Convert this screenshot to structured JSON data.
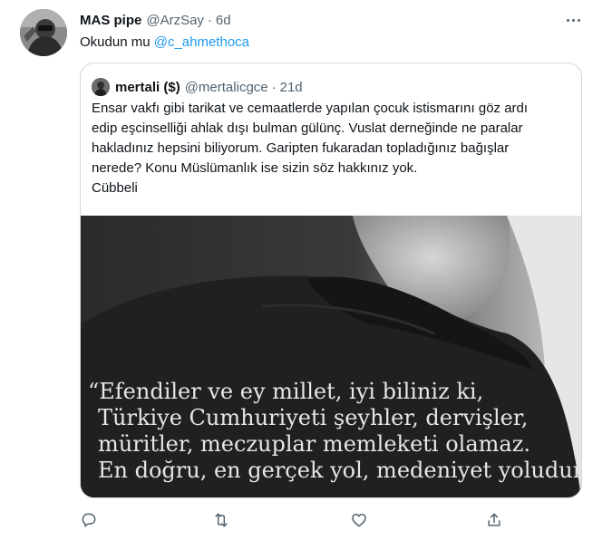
{
  "tweet": {
    "author_name": "MAS pipe",
    "author_handle": "@ArzSay",
    "separator": "·",
    "time": "6d",
    "text_prefix": "Okudun mu ",
    "mention": "@c_ahmethoca"
  },
  "quoted": {
    "author_name": "mertali ($)",
    "author_handle": "@mertalicgce",
    "separator": "·",
    "time": "21d",
    "lines": [
      "Ensar vakfı gibi tarikat ve cemaatlerde yapılan çocuk istismarını göz ardı",
      "edip eşcinselliği ahlak dışı bulman gülünç. Vuslat derneğinde ne paralar",
      "hakladınız hepsini biliyorum. Garipten fukaradan topladığınız bağışlar",
      "nerede? Konu Müslümanlık ise sizin söz hakkınız yok.",
      "Cübbeli"
    ],
    "image_quote": [
      "“Efendiler ve ey millet, iyi biliniz ki,",
      "Türkiye Cumhuriyeti şeyhler, dervişler,",
      "müritler, meczuplar memleketi olamaz.",
      "En doğru, en gerçek yol, medeniyet yoludur.”"
    ]
  },
  "icons": {
    "more": "more-options-icon",
    "reply": "reply-icon",
    "retweet": "retweet-icon",
    "like": "like-icon",
    "share": "share-icon"
  },
  "colors": {
    "text": "#0f1419",
    "secondary": "#536471",
    "accent": "#1d9bf0",
    "border": "#cfd9de"
  }
}
